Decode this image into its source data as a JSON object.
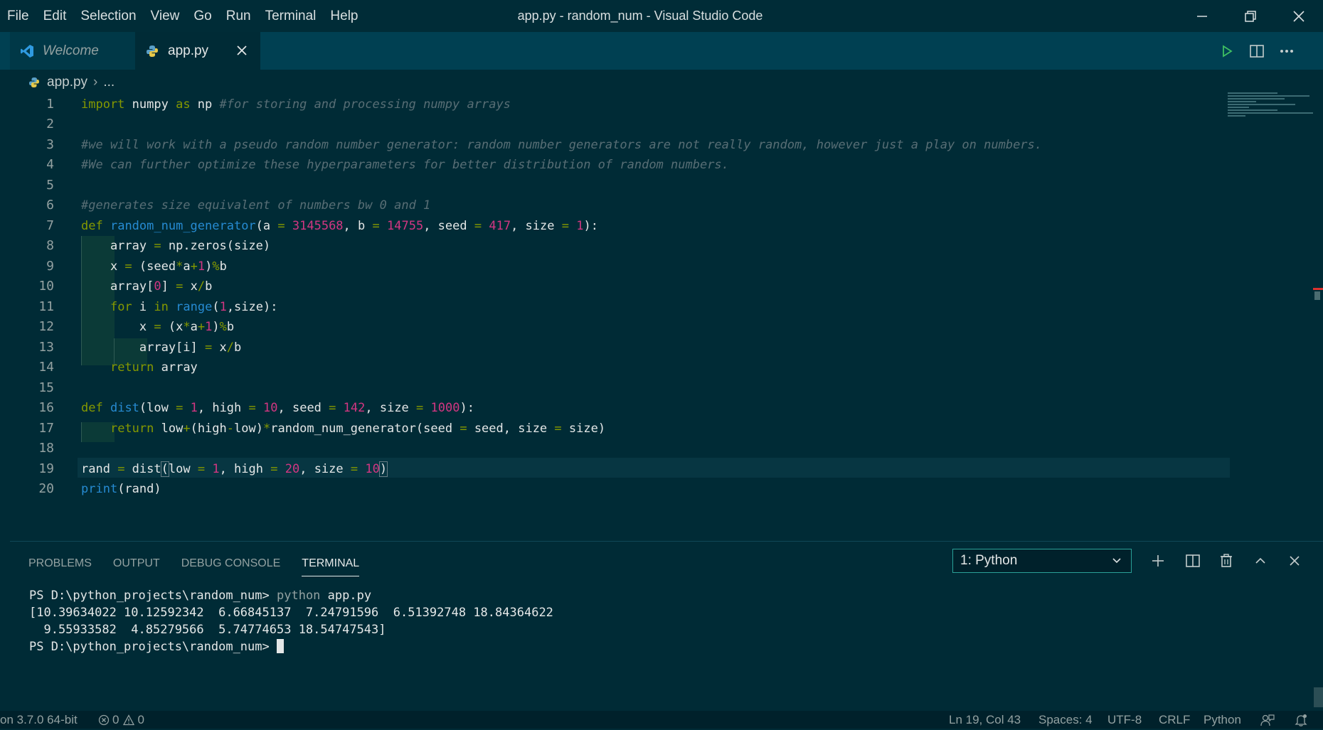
{
  "menu": [
    "File",
    "Edit",
    "Selection",
    "View",
    "Go",
    "Run",
    "Terminal",
    "Help"
  ],
  "window_title": "app.py - random_num - Visual Studio Code",
  "tabs": [
    {
      "label": "Welcome",
      "icon": "vscode-logo-icon"
    },
    {
      "label": "app.py",
      "icon": "python-file-icon"
    }
  ],
  "breadcrumb": {
    "file": "app.py",
    "rest": "..."
  },
  "editor": {
    "line_numbers": [
      "1",
      "2",
      "3",
      "4",
      "5",
      "6",
      "7",
      "8",
      "9",
      "10",
      "11",
      "12",
      "13",
      "14",
      "15",
      "16",
      "17",
      "18",
      "19",
      "20"
    ],
    "current_line": 19
  },
  "panel": {
    "tabs": [
      "PROBLEMS",
      "OUTPUT",
      "DEBUG CONSOLE",
      "TERMINAL"
    ],
    "active_tab": "TERMINAL",
    "terminal_select": "1: Python",
    "terminal_lines": {
      "prompt1": "PS D:\\python_projects\\random_num> ",
      "cmd": "python ",
      "arg": "app.py",
      "out1": "[10.39634022 10.12592342  6.66845137  7.24791596  6.51392748 18.84364622",
      "out2": "  9.55933582  4.85279566  5.74774653 18.54747543]",
      "prompt2": "PS D:\\python_projects\\random_num> "
    }
  },
  "status": {
    "interpreter": "on 3.7.0 64-bit",
    "errors": "0",
    "warnings": "0",
    "position": "Ln 19, Col 43",
    "spaces": "Spaces: 4",
    "encoding": "UTF-8",
    "eol": "CRLF",
    "language": "Python"
  },
  "colors": {
    "background": "#002b36",
    "keyword": "#859900",
    "function": "#268bd2",
    "number": "#d33682",
    "comment": "#586e75"
  }
}
